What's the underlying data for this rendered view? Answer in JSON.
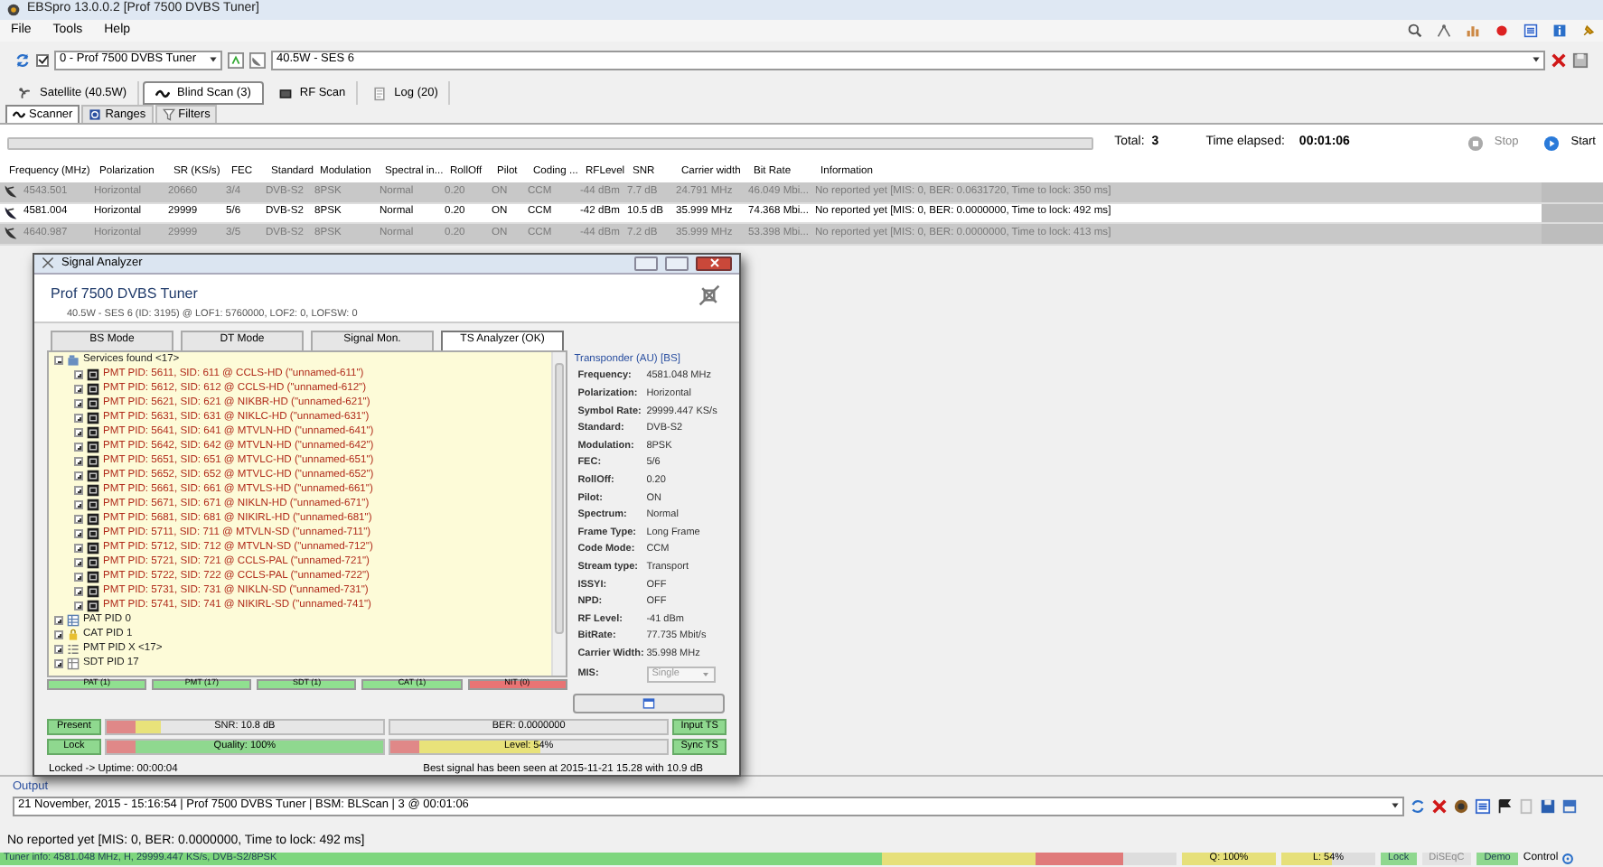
{
  "window": {
    "title": "EBSpro 13.0.0.2 [Prof 7500 DVBS Tuner]"
  },
  "menu": [
    "File",
    "Tools",
    "Help"
  ],
  "toolbar": {
    "tuner_checked": true,
    "tuner": "0 - Prof 7500 DVBS Tuner",
    "satellite": "40.5W - SES 6"
  },
  "tabs": [
    {
      "label": "Satellite (40.5W)",
      "kind": "satellite",
      "selected": false
    },
    {
      "label": "Blind Scan (3)",
      "kind": "blind",
      "selected": true
    },
    {
      "label": "RF Scan",
      "kind": "rf",
      "selected": false
    },
    {
      "label": "Log (20)",
      "kind": "log",
      "selected": false
    }
  ],
  "subtabs": [
    {
      "label": "Scanner",
      "kind": "scanner",
      "selected": true
    },
    {
      "label": "Ranges",
      "kind": "ranges",
      "selected": false
    },
    {
      "label": "Filters",
      "kind": "filters",
      "selected": false
    }
  ],
  "scan": {
    "level": 1,
    "total_label": "Total:",
    "total": "3",
    "elapsed_label": "Time elapsed:",
    "elapsed": "00:01:06",
    "stop": "Stop",
    "stop_disabled": true,
    "start": "Start"
  },
  "table": {
    "columns": [
      "Frequency (MHz)",
      "Polarization",
      "SR (KS/s)",
      "FEC",
      "Standard",
      "Modulation",
      "Spectral in...",
      "RollOff",
      "Pilot",
      "Coding ...",
      "RFLevel",
      "SNR",
      "Carrier width",
      "Bit Rate",
      "Information"
    ],
    "rows": [
      {
        "selected": false,
        "cells": [
          "4543.501",
          "Horizontal",
          "20660",
          "3/4",
          "DVB-S2",
          "8PSK",
          "Normal",
          "0.20",
          "ON",
          "CCM",
          "-44 dBm",
          "7.7 dB",
          "24.791 MHz",
          "46.049 Mbi...",
          "No reported yet [MIS: 0, BER: 0.0631720, Time to lock: 350 ms]"
        ]
      },
      {
        "selected": true,
        "cells": [
          "4581.004",
          "Horizontal",
          "29999",
          "5/6",
          "DVB-S2",
          "8PSK",
          "Normal",
          "0.20",
          "ON",
          "CCM",
          "-42 dBm",
          "10.5 dB",
          "35.999 MHz",
          "74.368 Mbi...",
          "No reported yet [MIS: 0, BER: 0.0000000, Time to lock: 492 ms]"
        ]
      },
      {
        "selected": false,
        "cells": [
          "4640.987",
          "Horizontal",
          "29999",
          "3/5",
          "DVB-S2",
          "8PSK",
          "Normal",
          "0.20",
          "ON",
          "CCM",
          "-44 dBm",
          "7.2 dB",
          "35.999 MHz",
          "53.398 Mbi...",
          "No reported yet [MIS: 0, BER: 0.0000000, Time to lock: 413 ms]"
        ]
      }
    ]
  },
  "signal_analyzer": {
    "title": "Signal Analyzer",
    "tuner": "Prof 7500 DVBS Tuner",
    "info": "40.5W - SES 6 (ID: 3195) @ LOF1: 5760000, LOF2: 0, LOFSW: 0",
    "tabs": [
      {
        "label": "BS Mode",
        "selected": false
      },
      {
        "label": "DT Mode",
        "selected": false
      },
      {
        "label": "Signal Mon.",
        "selected": false
      },
      {
        "label": "TS Analyzer (OK)",
        "selected": true
      }
    ],
    "tree": [
      {
        "label": "Services found <17>",
        "kind": "services",
        "expanded": true,
        "children": [
          {
            "label": "PMT PID: 5611, SID: 611 @ CCLS-HD (\"unnamed-611\")",
            "kind": "pmt",
            "expanded": false
          },
          {
            "label": "PMT PID: 5612, SID: 612 @ CCLS-HD (\"unnamed-612\")",
            "kind": "pmt",
            "expanded": false
          },
          {
            "label": "PMT PID: 5621, SID: 621 @ NIKBR-HD (\"unnamed-621\")",
            "kind": "pmt",
            "expanded": false
          },
          {
            "label": "PMT PID: 5631, SID: 631 @ NIKLC-HD (\"unnamed-631\")",
            "kind": "pmt",
            "expanded": false
          },
          {
            "label": "PMT PID: 5641, SID: 641 @ MTVLN-HD (\"unnamed-641\")",
            "kind": "pmt",
            "expanded": false
          },
          {
            "label": "PMT PID: 5642, SID: 642 @ MTVLN-HD (\"unnamed-642\")",
            "kind": "pmt",
            "expanded": false
          },
          {
            "label": "PMT PID: 5651, SID: 651 @ MTVLC-HD (\"unnamed-651\")",
            "kind": "pmt",
            "expanded": false
          },
          {
            "label": "PMT PID: 5652, SID: 652 @ MTVLC-HD (\"unnamed-652\")",
            "kind": "pmt",
            "expanded": false
          },
          {
            "label": "PMT PID: 5661, SID: 661 @ MTVLS-HD (\"unnamed-661\")",
            "kind": "pmt",
            "expanded": false
          },
          {
            "label": "PMT PID: 5671, SID: 671 @ NIKLN-HD (\"unnamed-671\")",
            "kind": "pmt",
            "expanded": false
          },
          {
            "label": "PMT PID: 5681, SID: 681 @ NIKIRL-HD (\"unnamed-681\")",
            "kind": "pmt",
            "expanded": false
          },
          {
            "label": "PMT PID: 5711, SID: 711 @ MTVLN-SD (\"unnamed-711\")",
            "kind": "pmt",
            "expanded": false
          },
          {
            "label": "PMT PID: 5712, SID: 712 @ MTVLN-SD (\"unnamed-712\")",
            "kind": "pmt",
            "expanded": false
          },
          {
            "label": "PMT PID: 5721, SID: 721 @ CCLS-PAL (\"unnamed-721\")",
            "kind": "pmt",
            "expanded": false
          },
          {
            "label": "PMT PID: 5722, SID: 722 @ CCLS-PAL (\"unnamed-722\")",
            "kind": "pmt",
            "expanded": false
          },
          {
            "label": "PMT PID: 5731, SID: 731 @ NIKLN-SD (\"unnamed-731\")",
            "kind": "pmt",
            "expanded": false
          },
          {
            "label": "PMT PID: 5741, SID: 741 @ NIKIRL-SD (\"unnamed-741\")",
            "kind": "pmt",
            "expanded": false
          }
        ]
      },
      {
        "label": "PAT PID 0",
        "kind": "pat",
        "expanded": false
      },
      {
        "label": "CAT PID 1",
        "kind": "cat",
        "expanded": false
      },
      {
        "label": "PMT PID X <17>",
        "kind": "list",
        "expanded": false
      },
      {
        "label": "SDT PID 17",
        "kind": "sdt",
        "expanded": false
      }
    ],
    "tables": [
      {
        "label": "PAT (1)",
        "color": "#90e090"
      },
      {
        "label": "PMT (17)",
        "color": "#90e090"
      },
      {
        "label": "SDT (1)",
        "color": "#90e090"
      },
      {
        "label": "CAT (1)",
        "color": "#90e090"
      },
      {
        "label": "NIT (0)",
        "color": "#e87474"
      }
    ],
    "transponder": {
      "title": "Transponder (AU) [BS]",
      "fields": [
        {
          "label": "Frequency:",
          "value": "4581.048 MHz"
        },
        {
          "label": "Polarization:",
          "value": "Horizontal"
        },
        {
          "label": "Symbol Rate:",
          "value": "29999.447 KS/s"
        },
        {
          "label": "Standard:",
          "value": "DVB-S2"
        },
        {
          "label": "Modulation:",
          "value": "8PSK"
        },
        {
          "label": "FEC:",
          "value": "5/6"
        },
        {
          "label": "RollOff:",
          "value": "0.20"
        },
        {
          "label": "Pilot:",
          "value": "ON"
        },
        {
          "label": "Spectrum:",
          "value": "Normal"
        },
        {
          "label": "Frame Type:",
          "value": "Long Frame"
        },
        {
          "label": "Code Mode:",
          "value": "CCM"
        },
        {
          "label": "Stream type:",
          "value": "Transport"
        },
        {
          "label": "ISSYI:",
          "value": "OFF"
        },
        {
          "label": "NPD:",
          "value": "OFF"
        },
        {
          "label": "RF Level:",
          "value": "-41 dBm"
        },
        {
          "label": "BitRate:",
          "value": "77.735 Mbit/s"
        },
        {
          "label": "Carrier Width:",
          "value": "35.998 MHz"
        }
      ],
      "mis_label": "MIS:",
      "mis": "Single"
    },
    "indicators": {
      "present": "Present",
      "snr": {
        "text": "SNR: 10.8 dB",
        "level": 0.2
      },
      "ber": "BER: 0.0000000",
      "input_ts": "Input TS",
      "lock": "Lock",
      "quality": {
        "text": "Quality: 100%",
        "level": 1
      },
      "level": {
        "text": "Level: 54%",
        "level": 0.54
      },
      "sync_ts": "Sync TS"
    },
    "status": "Locked -> Uptime: 00:00:04",
    "best": "Best signal has been seen at 2015-11-21 15.28 with 10.9 dB"
  },
  "output": {
    "label": "Output",
    "value": "21 November, 2015 - 15:16:54 | Prof 7500 DVBS Tuner | BSM: BLScan | 3 @ 00:01:06"
  },
  "message": "No reported yet [MIS: 0, BER: 0.0000000, Time to lock: 492 ms]",
  "status_bar": {
    "tuner_info": "Tuner info: 4581.048 MHz, H, 29999.447 KS/s, DVB-S2/8PSK",
    "quality": {
      "text": "Q: 100%",
      "level": 1
    },
    "level": {
      "text": "L: 54%",
      "level": 0.54
    },
    "lamps": [
      {
        "label": "Lock",
        "on": true
      },
      {
        "label": "DiSEqC",
        "on": false
      },
      {
        "label": "Demo",
        "on": true
      }
    ],
    "control": "Control"
  }
}
